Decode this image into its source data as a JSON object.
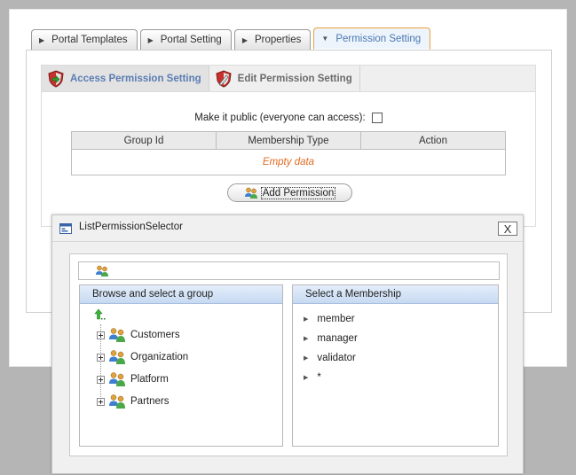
{
  "tabs": [
    {
      "label": "Portal Templates",
      "active": false
    },
    {
      "label": "Portal Setting",
      "active": false
    },
    {
      "label": "Properties",
      "active": false
    },
    {
      "label": "Permission Setting",
      "active": true
    }
  ],
  "inner_tabs": [
    {
      "label": "Access Permission Setting",
      "active": true,
      "icon": "shield-arrow-icon"
    },
    {
      "label": "Edit Permission Setting",
      "active": false,
      "icon": "shield-pencil-icon"
    }
  ],
  "public_label": "Make it public (everyone can access):",
  "public_checked": false,
  "table": {
    "columns": [
      "Group Id",
      "Membership Type",
      "Action"
    ],
    "empty_text": "Empty data"
  },
  "add_permission_label": "Add Permission",
  "popup": {
    "title": "ListPermissionSelector",
    "close_label": "X",
    "group_header": "Browse and select a group",
    "groups": [
      "Customers",
      "Organization",
      "Platform",
      "Partners"
    ],
    "membership_header": "Select a Membership",
    "memberships": [
      "member",
      "manager",
      "validator",
      "*"
    ]
  },
  "colors": {
    "active_tab_border": "#e8a33a",
    "active_tab_text": "#4a78b3",
    "empty_text": "#e06a1f",
    "header_gradient": "#c7d9f2"
  }
}
